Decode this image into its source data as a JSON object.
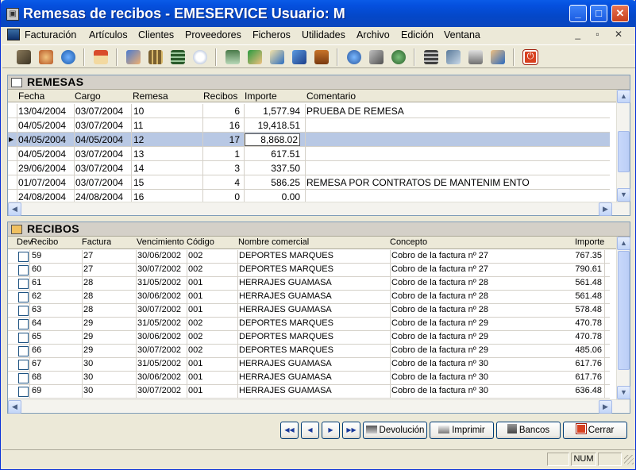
{
  "window": {
    "title": "Remesas de recibos - EMESERVICE Usuario: M"
  },
  "menu": [
    "Facturación",
    "Artículos",
    "Clientes",
    "Proveedores",
    "Ficheros",
    "Utilidades",
    "Archivo",
    "Edición",
    "Ventana"
  ],
  "toolbar_icons": [
    "open-book-icon",
    "people-globe-icon",
    "globe-icon",
    "home-icon",
    "people-icon",
    "calc-icon",
    "calculator-icon",
    "clock-icon",
    "print-preview-icon",
    "people-add-icon",
    "contacts-icon",
    "network-icon",
    "briefcase-icon",
    "globe2-icon",
    "box-icon",
    "printer-globe-icon",
    "stamp-icon",
    "notebook-icon",
    "printer-icon",
    "user-card-icon",
    "power-icon"
  ],
  "remesas": {
    "title": "REMESAS",
    "columns": [
      "Fecha",
      "Cargo",
      "Remesa",
      "Recibos",
      "Importe",
      "Comentario"
    ],
    "rows": [
      {
        "fecha": "13/04/2004",
        "cargo": "03/07/2004",
        "remesa": "10",
        "recibos": "6",
        "importe": "1,577.94",
        "comentario": "PRUEBA DE REMESA"
      },
      {
        "fecha": "04/05/2004",
        "cargo": "03/07/2004",
        "remesa": "11",
        "recibos": "16",
        "importe": "19,418.51",
        "comentario": ""
      },
      {
        "fecha": "04/05/2004",
        "cargo": "04/05/2004",
        "remesa": "12",
        "recibos": "17",
        "importe": "8,868.02",
        "comentario": ""
      },
      {
        "fecha": "04/05/2004",
        "cargo": "03/07/2004",
        "remesa": "13",
        "recibos": "1",
        "importe": "617.51",
        "comentario": ""
      },
      {
        "fecha": "29/06/2004",
        "cargo": "03/07/2004",
        "remesa": "14",
        "recibos": "3",
        "importe": "337.50",
        "comentario": ""
      },
      {
        "fecha": "01/07/2004",
        "cargo": "03/07/2004",
        "remesa": "15",
        "recibos": "4",
        "importe": "586.25",
        "comentario": "REMESA POR CONTRATOS DE MANTENIM ENTO"
      },
      {
        "fecha": "24/08/2004",
        "cargo": "24/08/2004",
        "remesa": "16",
        "recibos": "0",
        "importe": "0.00",
        "comentario": ""
      }
    ]
  },
  "recibos": {
    "title": "RECIBOS",
    "columns": [
      "Dev",
      "Recibo",
      "Factura",
      "Vencimiento",
      "Código",
      "Nombre comercial",
      "Concepto",
      "Importe"
    ],
    "rows": [
      {
        "recibo": "59",
        "factura": "27",
        "venc": "30/06/2002",
        "codigo": "002",
        "nombre": "DEPORTES MARQUES",
        "concepto": "Cobro de la factura nº 27",
        "importe": "767.35"
      },
      {
        "recibo": "60",
        "factura": "27",
        "venc": "30/07/2002",
        "codigo": "002",
        "nombre": "DEPORTES MARQUES",
        "concepto": "Cobro de la factura nº 27",
        "importe": "790.61"
      },
      {
        "recibo": "61",
        "factura": "28",
        "venc": "31/05/2002",
        "codigo": "001",
        "nombre": "HERRAJES GUAMASA",
        "concepto": "Cobro de la factura nº 28",
        "importe": "561.48"
      },
      {
        "recibo": "62",
        "factura": "28",
        "venc": "30/06/2002",
        "codigo": "001",
        "nombre": "HERRAJES GUAMASA",
        "concepto": "Cobro de la factura nº 28",
        "importe": "561.48"
      },
      {
        "recibo": "63",
        "factura": "28",
        "venc": "30/07/2002",
        "codigo": "001",
        "nombre": "HERRAJES GUAMASA",
        "concepto": "Cobro de la factura nº 28",
        "importe": "578.48"
      },
      {
        "recibo": "64",
        "factura": "29",
        "venc": "31/05/2002",
        "codigo": "002",
        "nombre": "DEPORTES MARQUES",
        "concepto": "Cobro de la factura nº 29",
        "importe": "470.78"
      },
      {
        "recibo": "65",
        "factura": "29",
        "venc": "30/06/2002",
        "codigo": "002",
        "nombre": "DEPORTES MARQUES",
        "concepto": "Cobro de la factura nº 29",
        "importe": "470.78"
      },
      {
        "recibo": "66",
        "factura": "29",
        "venc": "30/07/2002",
        "codigo": "002",
        "nombre": "DEPORTES MARQUES",
        "concepto": "Cobro de la factura nº 29",
        "importe": "485.06"
      },
      {
        "recibo": "67",
        "factura": "30",
        "venc": "31/05/2002",
        "codigo": "001",
        "nombre": "HERRAJES GUAMASA",
        "concepto": "Cobro de la factura nº 30",
        "importe": "617.76"
      },
      {
        "recibo": "68",
        "factura": "30",
        "venc": "30/06/2002",
        "codigo": "001",
        "nombre": "HERRAJES GUAMASA",
        "concepto": "Cobro de la factura nº 30",
        "importe": "617.76"
      },
      {
        "recibo": "69",
        "factura": "30",
        "venc": "30/07/2002",
        "codigo": "001",
        "nombre": "HERRAJES GUAMASA",
        "concepto": "Cobro de la factura nº 30",
        "importe": "636.48"
      }
    ]
  },
  "buttons": {
    "devolucion": "Devolución",
    "imprimir": "Imprimir",
    "bancos": "Bancos",
    "cerrar": "Cerrar"
  },
  "status": {
    "num": "NUM"
  }
}
